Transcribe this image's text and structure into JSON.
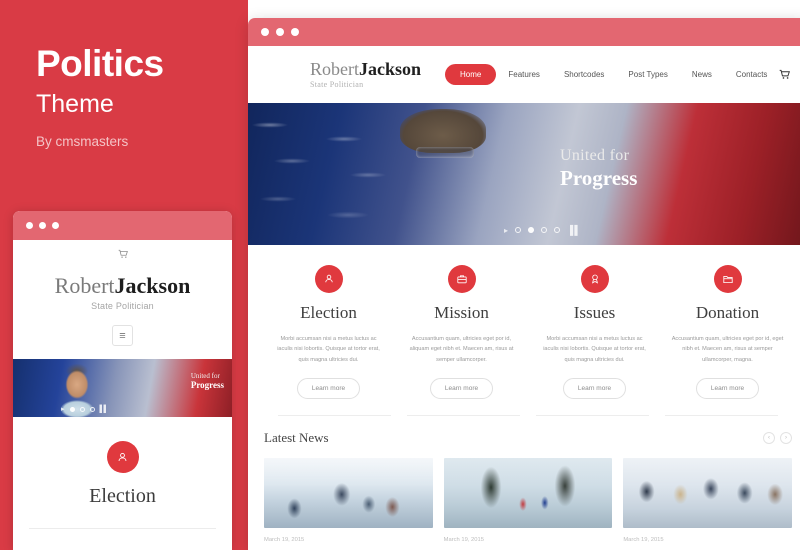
{
  "promo": {
    "title": "Politics",
    "subtitle": "Theme",
    "byline": "By cmsmasters",
    "accent": "#d93b45"
  },
  "window": {
    "bar_color": "#e36771",
    "dot_color": "#ffffff",
    "dots": [
      "dot",
      "dot",
      "dot"
    ]
  },
  "site": {
    "logo": {
      "first": "Robert",
      "second": "Jackson",
      "tagline": "State Politician"
    },
    "nav": {
      "items": [
        {
          "label": "Home",
          "active": true
        },
        {
          "label": "Features",
          "active": false
        },
        {
          "label": "Shortcodes",
          "active": false
        },
        {
          "label": "Post Types",
          "active": false
        },
        {
          "label": "News",
          "active": false
        },
        {
          "label": "Contacts",
          "active": false
        }
      ],
      "cart_icon": "cart-icon",
      "active_color": "#e0393e"
    },
    "hero": {
      "line1": "United for",
      "line2": "Progress",
      "slider": {
        "prev_icon": "chevron-right-icon",
        "dots": [
          {
            "active": false
          },
          {
            "active": true
          },
          {
            "active": false
          },
          {
            "active": false
          }
        ],
        "pause_icon": "pause-icon"
      }
    },
    "features": [
      {
        "icon": "person-badge-icon",
        "title": "Election",
        "text": "Morbi accumsan nisi a metus luctus ac iaculis nisi lobortis. Quisque at tortor erat, quis magna ultricies dui.",
        "button": "Learn more"
      },
      {
        "icon": "briefcase-icon",
        "title": "Mission",
        "text": "Accusantium quam, ultricies eget por id, aliquam eget nibh et. Maecen am, risus at semper ullamcorper.",
        "button": "Learn more"
      },
      {
        "icon": "award-ribbon-icon",
        "title": "Issues",
        "text": "Morbi accumsan nisi a metus luctus ac iaculis nisi lobortis. Quisque at tortor erat, quis magna ultricies dui.",
        "button": "Learn more"
      },
      {
        "icon": "folder-icon",
        "title": "Donation",
        "text": "Accusantium quam, ultricies eget por id, eget nibh et. Maecen am, risus at semper ullamcorper, magna.",
        "button": "Learn more"
      }
    ],
    "news": {
      "title": "Latest News",
      "prev_icon": "chevron-left-icon",
      "next_icon": "chevron-right-icon",
      "prev_label": "‹",
      "next_label": "›",
      "cards": [
        {
          "image": "boardroom-presentation-photo",
          "date": "March 19, 2015"
        },
        {
          "image": "handshake-with-flags-photo",
          "date": "March 19, 2015"
        },
        {
          "image": "business-meeting-photo",
          "date": "March 19, 2015"
        }
      ]
    }
  },
  "mobile": {
    "cart_icon": "cart-icon",
    "logo": {
      "first": "Robert",
      "second": "Jackson",
      "tagline": "State Politician"
    },
    "menu_icon": "hamburger-menu-icon",
    "menu_glyph": "≡",
    "hero": {
      "line1": "United for",
      "line2": "Progress"
    },
    "feature": {
      "icon": "person-badge-icon",
      "title": "Election"
    }
  }
}
